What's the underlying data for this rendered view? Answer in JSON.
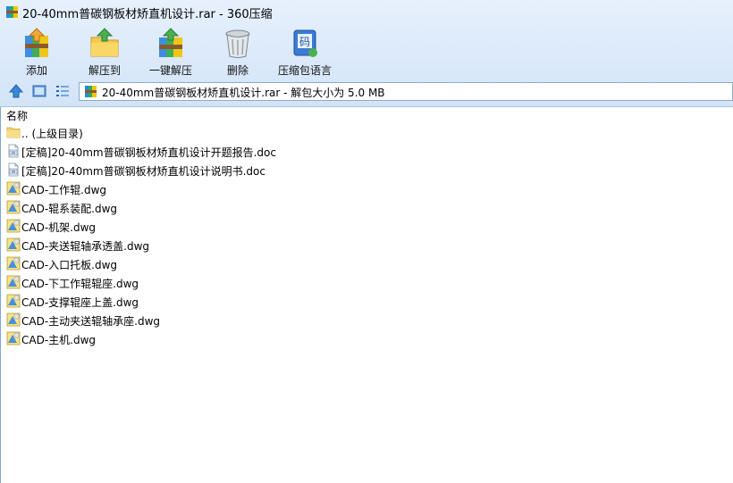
{
  "window": {
    "title": "20-40mm普碳钢板材矫直机设计.rar - 360压缩"
  },
  "toolbar": {
    "buttons": [
      {
        "label": "添加",
        "icon": "add-archive-icon"
      },
      {
        "label": "解压到",
        "icon": "extract-to-icon"
      },
      {
        "label": "一键解压",
        "icon": "one-click-extract-icon"
      },
      {
        "label": "删除",
        "icon": "trash-icon"
      },
      {
        "label": "压缩包语言",
        "icon": "archive-language-icon"
      }
    ]
  },
  "navbar": {
    "address_text": "20-40mm普碳钢板材矫直机设计.rar - 解包大小为 5.0 MB"
  },
  "list": {
    "column_name": "名称",
    "items": [
      {
        "name": ".. (上级目录)",
        "type": "parent-folder"
      },
      {
        "name": "[定稿]20-40mm普碳钢板材矫直机设计开题报告.doc",
        "type": "doc"
      },
      {
        "name": "[定稿]20-40mm普碳钢板材矫直机设计说明书.doc",
        "type": "doc"
      },
      {
        "name": "CAD-工作辊.dwg",
        "type": "dwg"
      },
      {
        "name": "CAD-辊系装配.dwg",
        "type": "dwg"
      },
      {
        "name": "CAD-机架.dwg",
        "type": "dwg"
      },
      {
        "name": "CAD-夹送辊轴承透盖.dwg",
        "type": "dwg"
      },
      {
        "name": "CAD-入口托板.dwg",
        "type": "dwg"
      },
      {
        "name": "CAD-下工作辊辊座.dwg",
        "type": "dwg"
      },
      {
        "name": "CAD-支撑辊座上盖.dwg",
        "type": "dwg"
      },
      {
        "name": "CAD-主动夹送辊轴承座.dwg",
        "type": "dwg"
      },
      {
        "name": "CAD-主机.dwg",
        "type": "dwg"
      }
    ]
  },
  "colors": {
    "chrome_bg": "#dbe9fa",
    "accent_blue": "#3a7bd5",
    "folder_yellow": "#f5d36b"
  }
}
